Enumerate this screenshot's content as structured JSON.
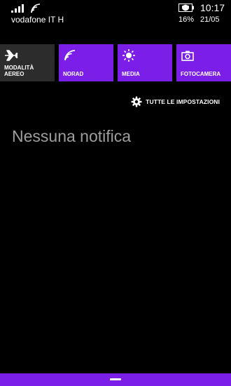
{
  "status": {
    "carrier": "vodafone IT H",
    "time": "10:17",
    "battery_percent": "16%",
    "date": "21/05",
    "icons": [
      "signal-icon",
      "wifi-icon",
      "battery-saver-icon"
    ]
  },
  "quick_actions": [
    {
      "label": "MODALITÀ AEREO",
      "icon": "airplane-icon",
      "active": false
    },
    {
      "label": "NORAD",
      "icon": "wifi-icon",
      "active": true
    },
    {
      "label": "MEDIA",
      "icon": "brightness-icon",
      "active": true
    },
    {
      "label": "FOTOCAMERA",
      "icon": "camera-icon",
      "active": true
    }
  ],
  "settings_link": {
    "label": "TUTTE LE IMPOSTAZIONI",
    "icon": "gear-icon"
  },
  "notifications": {
    "empty_text": "Nessuna notifica"
  },
  "colors": {
    "accent": "#7b1fe8",
    "tile_inactive": "#2c2c2c",
    "background": "#000000",
    "muted_text": "#9e9e9e"
  }
}
